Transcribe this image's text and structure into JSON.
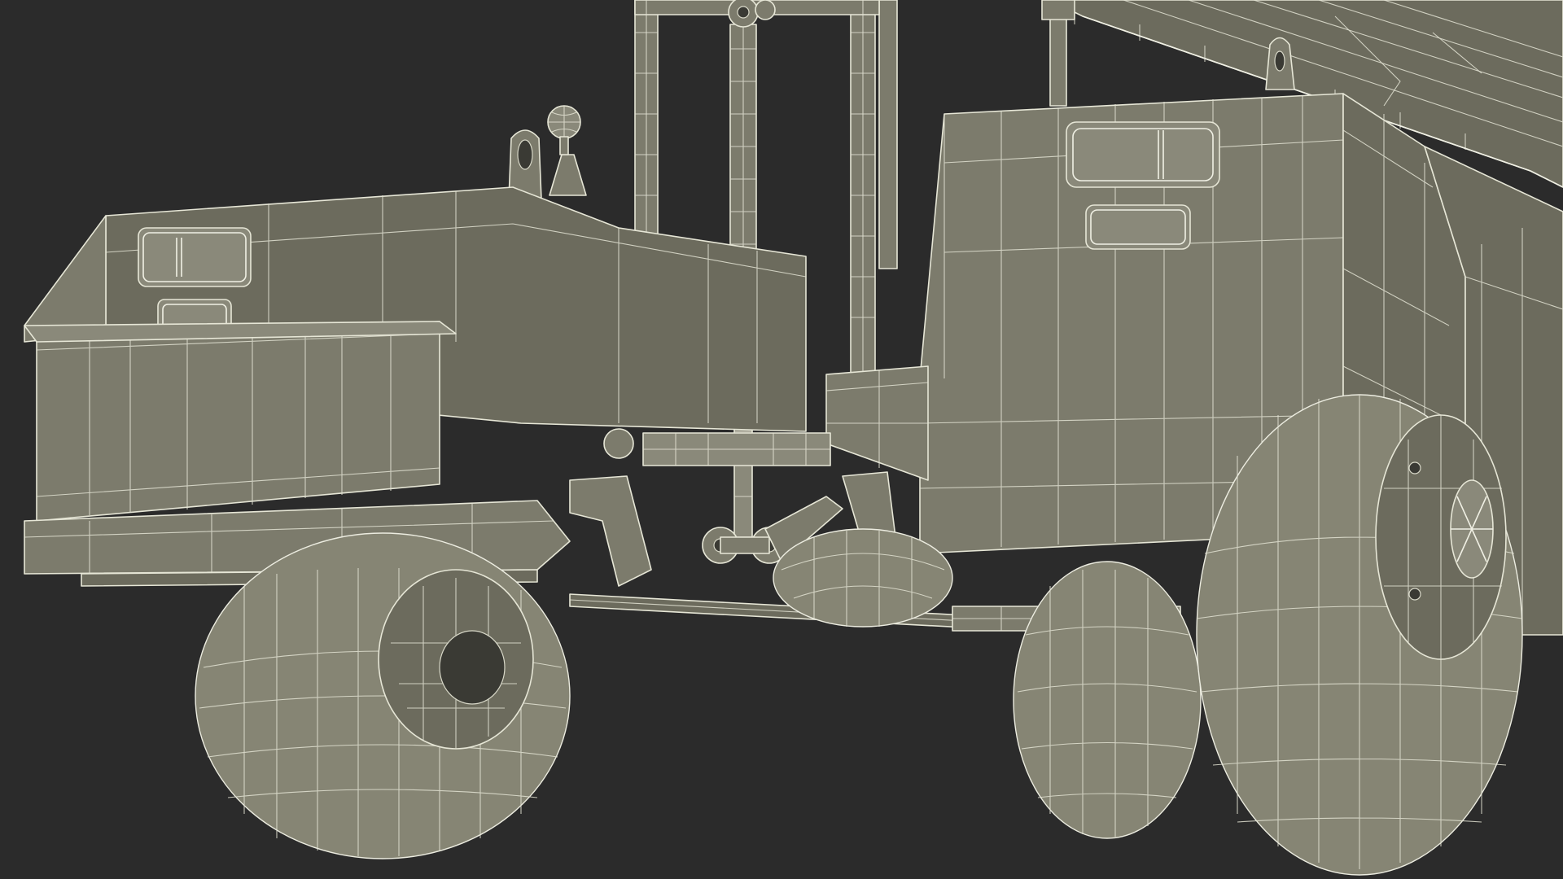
{
  "scene": {
    "background_color": "#2b2b2b",
    "model_fill_color": "#7c7b6c",
    "wire_color": "#e6e6d6",
    "render_style": "wireframe-on-shaded"
  }
}
